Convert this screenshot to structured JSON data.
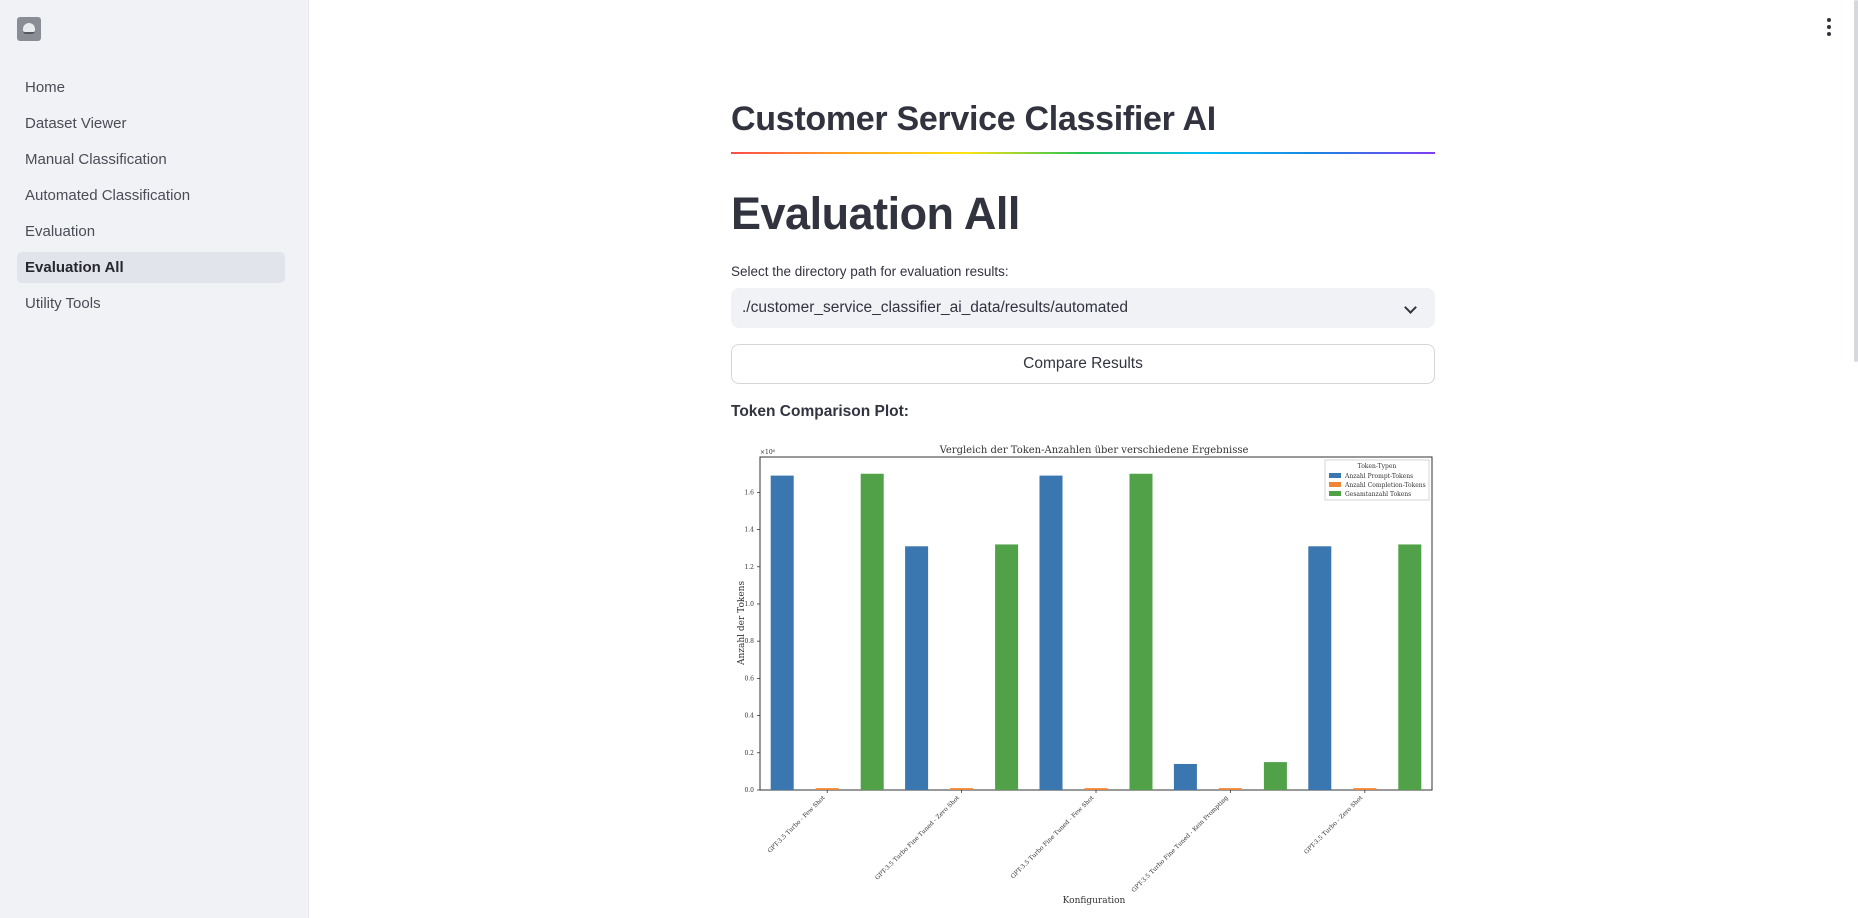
{
  "sidebar": {
    "items": [
      {
        "label": "Home",
        "active": false
      },
      {
        "label": "Dataset Viewer",
        "active": false
      },
      {
        "label": "Manual Classification",
        "active": false
      },
      {
        "label": "Automated Classification",
        "active": false
      },
      {
        "label": "Evaluation",
        "active": false
      },
      {
        "label": "Evaluation All",
        "active": true
      },
      {
        "label": "Utility Tools",
        "active": false
      }
    ]
  },
  "header": {
    "menu_icon": "vertical-ellipsis-icon",
    "logo_icon": "app-logo-icon"
  },
  "main": {
    "app_title": "Customer Service Classifier AI",
    "page_title": "Evaluation All",
    "select_label": "Select the directory path for evaluation results:",
    "select_value": "./customer_service_classifier_ai_data/results/automated",
    "compare_button": "Compare Results",
    "plot_label": "Token Comparison Plot:"
  },
  "colors": {
    "accent_blue": "#3a76af",
    "accent_orange": "#ef8636",
    "accent_green": "#51a148",
    "sidebar_bg": "#f0f2f6"
  },
  "chart_data": {
    "type": "bar",
    "title": "Vergleich der Token-Anzahlen über verschiedene Ergebnisse",
    "xlabel": "Konfiguration",
    "ylabel": "Anzahl der Tokens",
    "y_multiplier": "×10⁶",
    "ylim": [
      0,
      1.79
    ],
    "yticks": [
      "0.0",
      "0.2",
      "0.4",
      "0.6",
      "0.8",
      "1.0",
      "1.2",
      "1.4",
      "1.6"
    ],
    "categories": [
      "GPT-3.5 Turbo - Few Shot",
      "GPT-3.5 Turbo Fine Tuned - Zero Shot",
      "GPT-3.5 Turbo Fine Tuned - Few Shot",
      "GPT-3.5 Turbo Fine Tuned - Kein Prompting",
      "GPT-3.5 Turbo - Zero Shot"
    ],
    "legend_title": "Token-Typen",
    "legend_position": "top-right",
    "series": [
      {
        "name": "Anzahl Prompt-Tokens",
        "color": "#3a76af",
        "values": [
          1.69,
          1.31,
          1.69,
          0.14,
          1.31
        ]
      },
      {
        "name": "Anzahl Completion-Tokens",
        "color": "#ef8636",
        "values": [
          0.01,
          0.01,
          0.01,
          0.01,
          0.01
        ]
      },
      {
        "name": "Gesamtanzahl Tokens",
        "color": "#51a148",
        "values": [
          1.7,
          1.32,
          1.7,
          0.15,
          1.32
        ]
      }
    ]
  }
}
